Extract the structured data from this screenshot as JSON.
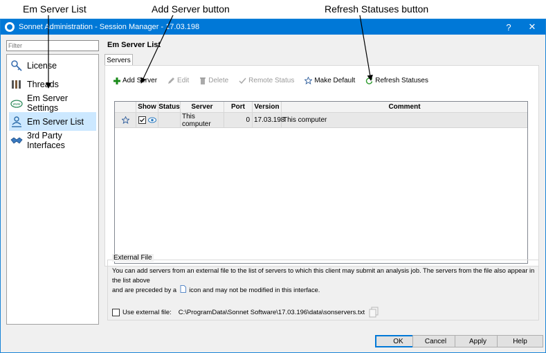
{
  "annotations": {
    "em_server_list": "Em Server List",
    "add_server_button": "Add Server button",
    "refresh_statuses_button": "Refresh Statuses button"
  },
  "window": {
    "title": "Sonnet Administration - Session Manager - 17.03.198",
    "help": "?",
    "close": "✕"
  },
  "sidebar": {
    "filter_placeholder": "Filter",
    "items": [
      {
        "label": "License",
        "icon": "key-icon"
      },
      {
        "label": "Threads",
        "icon": "threads-icon"
      },
      {
        "label": "Em Server Settings",
        "icon": "www-cloud-icon"
      },
      {
        "label": "Em Server List",
        "icon": "server-user-icon",
        "selected": true
      },
      {
        "label": "3rd Party Interfaces",
        "icon": "handshake-icon"
      }
    ]
  },
  "main": {
    "title": "Em Server List",
    "tab": "Servers",
    "toolbar": {
      "add_server": "Add Server",
      "edit": "Edit",
      "delete": "Delete",
      "remote_status": "Remote Status",
      "make_default": "Make Default",
      "refresh_statuses": "Refresh Statuses"
    },
    "table": {
      "columns": {
        "show": "Show",
        "status": "Status",
        "server": "Server",
        "port": "Port",
        "version": "Version",
        "comment": "Comment"
      },
      "rows": [
        {
          "server": "This computer",
          "port": "0",
          "version": "17.03.198",
          "comment": "This computer"
        }
      ]
    }
  },
  "external_file": {
    "legend": "External File",
    "description_1": "You can add servers from an external file to the list of servers to which this client may submit an analysis job. The servers from the file also appear in the list above",
    "description_2a": "and are preceded by a",
    "description_2b": "icon and may not be modified in this interface.",
    "use_label": "Use external file:",
    "path": "C:\\ProgramData\\Sonnet Software\\17.03.196\\data\\sonservers.txt"
  },
  "buttons": {
    "ok": "OK",
    "cancel": "Cancel",
    "apply": "Apply",
    "help": "Help"
  },
  "colors": {
    "titlebar": "#0078d7",
    "selection": "#cce8ff",
    "add_green": "#1a8a1a",
    "refresh_green": "#2e9b2e"
  }
}
